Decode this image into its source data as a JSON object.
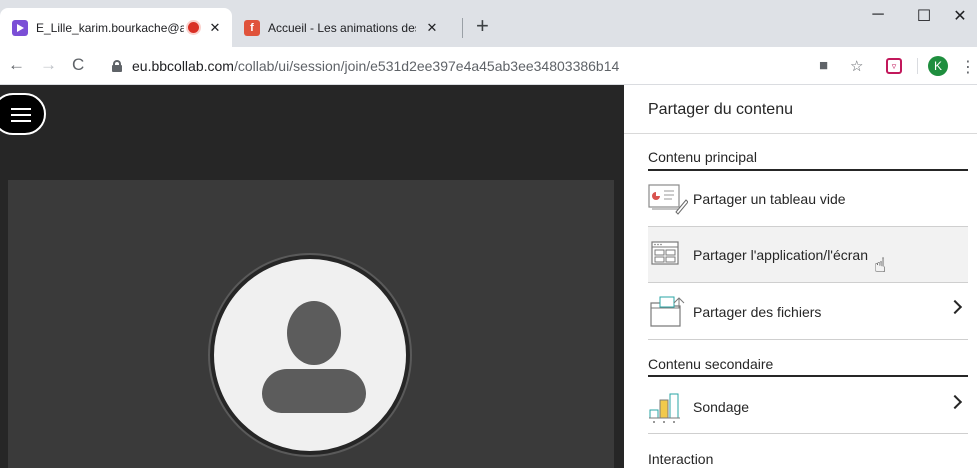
{
  "browser": {
    "tabs": [
      {
        "title": "E_Lille_karim.bourkache@ac",
        "favicon": "collaborate-icon",
        "favicon_color": "#7b4fd6",
        "recording": true,
        "active": true
      },
      {
        "title": "Accueil - Les animations des Fon",
        "favicon": "facebook-icon",
        "favicon_color": "#e0533b",
        "active": false
      }
    ],
    "new_tab": "+",
    "url_host": "eu.bbcollab.com",
    "url_path": "/collab/ui/session/join/e531d2ee397e4a45ab3ee34803386b14",
    "avatar_letter": "K",
    "avatar_color": "#1e8e3e"
  },
  "panel": {
    "title": "Partager du contenu",
    "primary": {
      "heading": "Contenu principal",
      "items": [
        {
          "label": "Partager un tableau vide",
          "icon": "whiteboard-icon",
          "chevron": false
        },
        {
          "label": "Partager l'application/l'écran",
          "icon": "screen-share-icon",
          "chevron": false,
          "hovered": true
        },
        {
          "label": "Partager des fichiers",
          "icon": "folder-icon",
          "chevron": true
        }
      ]
    },
    "secondary": {
      "heading": "Contenu secondaire",
      "items": [
        {
          "label": "Sondage",
          "icon": "poll-icon",
          "chevron": true
        }
      ]
    },
    "interaction": {
      "heading": "Interaction"
    }
  },
  "colors": {
    "stage_bg": "#262626",
    "video_bg": "#3a3a3a",
    "avatar_fg": "#5c5c5c",
    "accent_teal": "#2aa6a6"
  }
}
